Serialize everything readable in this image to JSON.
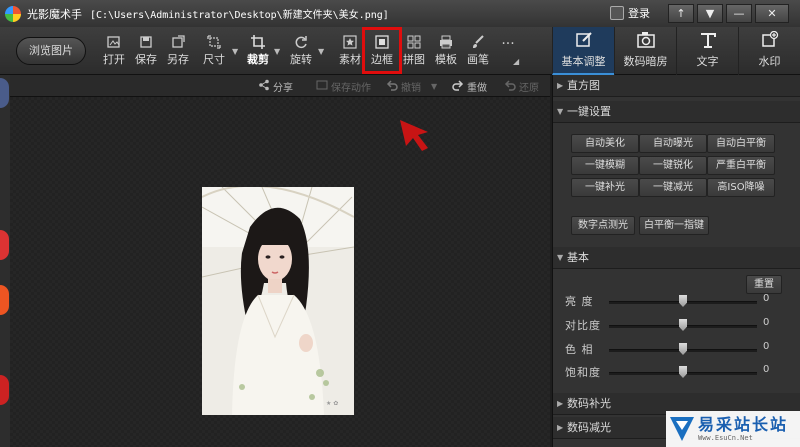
{
  "window": {
    "app_name": "光影魔术手",
    "file_path": "[C:\\Users\\Administrator\\Desktop\\新建文件夹\\美女.png]",
    "login_label": "登录",
    "controls": [
      "↑",
      "▼",
      "—",
      "✕"
    ]
  },
  "toolbar": {
    "browse_label": "浏览图片",
    "tools": [
      {
        "label": "打开",
        "icon": "image-plus-icon"
      },
      {
        "label": "保存",
        "icon": "save-icon"
      },
      {
        "label": "另存",
        "icon": "save-as-icon"
      },
      {
        "label": "尺寸",
        "icon": "resize-icon"
      },
      {
        "label": "裁剪",
        "icon": "crop-icon"
      },
      {
        "label": "旋转",
        "icon": "rotate-icon"
      },
      {
        "label": "素材",
        "icon": "star-icon"
      },
      {
        "label": "边框",
        "icon": "frame-icon"
      },
      {
        "label": "拼图",
        "icon": "grid-icon"
      },
      {
        "label": "模板",
        "icon": "print-icon"
      },
      {
        "label": "画笔",
        "icon": "brush-icon"
      },
      {
        "label": "",
        "icon": "more-icon"
      }
    ],
    "more_glyph": "···",
    "highlighted_tool": "边框"
  },
  "right_tabs": [
    {
      "label": "基本调整",
      "icon": "edit-icon",
      "active": true
    },
    {
      "label": "数码暗房",
      "icon": "camera-icon",
      "active": false
    },
    {
      "label": "文字",
      "icon": "text-icon",
      "active": false
    },
    {
      "label": "水印",
      "icon": "watermark-icon",
      "active": false
    }
  ],
  "subbar": {
    "share": "分享",
    "save_action": "保存动作",
    "undo": "撤销",
    "redo": "重做",
    "restore": "还原"
  },
  "panel": {
    "histogram": "直方图",
    "one_click": {
      "title": "一键设置",
      "buttons": [
        "自动美化",
        "自动曝光",
        "自动白平衡",
        "一键模糊",
        "一键锐化",
        "严重白平衡",
        "一键补光",
        "一键减光",
        "高ISO降噪"
      ],
      "extra_buttons": [
        "数字点测光",
        "白平衡一指键"
      ]
    },
    "basic": {
      "title": "基本",
      "reset": "重置",
      "sliders": [
        {
          "label": "亮 度",
          "value": 0,
          "level": 0.5
        },
        {
          "label": "对比度",
          "value": 0,
          "level": 0.5
        },
        {
          "label": "色 相",
          "value": 0,
          "level": 0.5
        },
        {
          "label": "饱和度",
          "value": 0,
          "level": 0.5
        }
      ]
    },
    "digital_fill": "数码补光",
    "digital_reduce": "数码减光"
  },
  "watermark": {
    "main": "易采站长站",
    "sub": "Www.EsuCn.Net"
  },
  "colors": {
    "highlight": "#e00d0d",
    "active_tab": "#1f3b5c",
    "watermark_blue": "#1a5fb0"
  }
}
